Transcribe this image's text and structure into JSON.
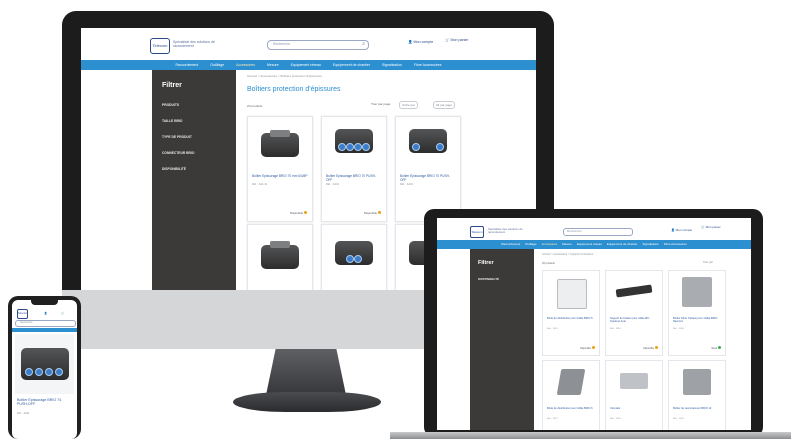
{
  "site": {
    "logo_text": "Telecom",
    "tagline": "Spécialiste des solutions de raccordement",
    "search_placeholder": "Recherche",
    "account_label": "Mon compte",
    "cart_label": "Mon panier"
  },
  "nav": {
    "items": [
      "Raccordement",
      "Outillage",
      "Accessoires",
      "Mesure",
      "Equipement réseau",
      "Equipement de chantier",
      "Signalisation",
      "Fibre Accessoires"
    ],
    "active_index": 2
  },
  "desktop": {
    "breadcrumb": "Accueil > Accessoires > Boîtiers protection d'épissures",
    "page_title": "Boîtiers protection d'épissures",
    "count_label": "20 produits",
    "sort_label": "Trier par page",
    "sort_value": "Ordre par",
    "per_page_value": "24 par page",
    "filter_title": "Filtrer",
    "filters": [
      "PRODUITS",
      "TAILLE BRIO",
      "TYPE DE PRODUIT",
      "CONNECTEUR BRIO",
      "DISPONIBILITÉ"
    ],
    "products": [
      {
        "title": "Boîtier Epissurage BRIO 70 mm 6/4/8P",
        "ref": "Réf. : 4A1-11",
        "dispo": "Disponible"
      },
      {
        "title": "Boîtier Epissurage BRIO 70 PUSH-OFF",
        "ref": "Réf. : 4A01",
        "dispo": "Disponible"
      },
      {
        "title": "Boîtier Epissurage BRIO 70 PUSH-OFF",
        "ref": "Réf. : 4A01",
        "dispo": ""
      }
    ]
  },
  "laptop": {
    "breadcrumb": "Accueil > Accessoires > Supports & fixations",
    "count_label": "20 produits",
    "sort_value": "Trier par",
    "filter_title": "Filtrer",
    "filters": [
      "DISPONIBILITÉ"
    ],
    "products": [
      {
        "title": "Boîte de distribution pour Câble BRIO 5",
        "ref": "Réf. : 1015",
        "dispo": "Disponible"
      },
      {
        "title": "Support de fixation pour câble Ø6 - Système Auto",
        "ref": "Réf. : 1016",
        "dispo": "Disponible"
      },
      {
        "title": "Boîtier Fibre Optique pour Câble BRIO Raccord",
        "ref": "Réf. : 1020",
        "dispo": "Stock"
      },
      {
        "title": "Boîte de distribution pour Câble BRIO 6",
        "ref": "Réf. : 1017",
        "dispo": ""
      },
      {
        "title": "Clé plate",
        "ref": "Réf. : 1018",
        "dispo": ""
      },
      {
        "title": "Boîtier de raccordement BRIO 12",
        "ref": "Réf. : 1019",
        "dispo": ""
      }
    ]
  },
  "phone": {
    "search_placeholder": "Recherche",
    "product_title": "Boîtier Epissurage BRIO 74 PUSH-OFF",
    "ref": "Réf. : 4A01"
  },
  "colors": {
    "brand_blue": "#2c8fd0",
    "sidebar": "#3c3a38",
    "stock_dot": "#e8a317"
  }
}
